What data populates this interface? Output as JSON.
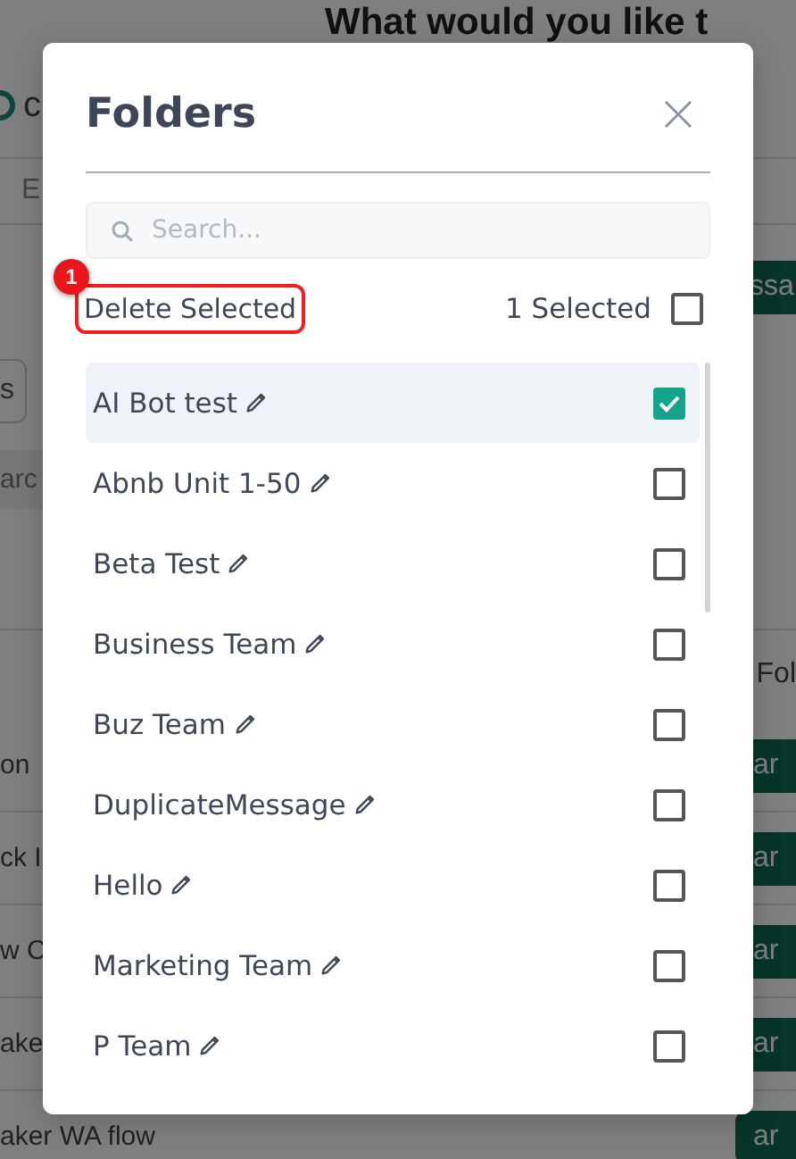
{
  "background": {
    "heading": "What would you like t",
    "logo_text": "c",
    "tab_text": "E",
    "top_button": "ssa",
    "left_button": "s",
    "search_text": "arc",
    "column_header": "Fol",
    "rows": [
      {
        "name": "on",
        "action": "ar"
      },
      {
        "name": "ck I",
        "action": "ar"
      },
      {
        "name": "w C",
        "action": "ar"
      },
      {
        "name": "ake",
        "action": "ar"
      },
      {
        "name": "aker WA flow",
        "action": "ar"
      }
    ]
  },
  "dialog": {
    "title": "Folders",
    "search": {
      "placeholder": "Search..."
    },
    "delete_button": "Delete Selected",
    "selected_count": "1 Selected",
    "select_all_checked": false,
    "folders": [
      {
        "name": "AI Bot test",
        "checked": true,
        "selected": true
      },
      {
        "name": "Abnb Unit 1-50",
        "checked": false,
        "selected": false
      },
      {
        "name": "Beta Test",
        "checked": false,
        "selected": false
      },
      {
        "name": "Business Team",
        "checked": false,
        "selected": false
      },
      {
        "name": "Buz Team",
        "checked": false,
        "selected": false
      },
      {
        "name": "DuplicateMessage",
        "checked": false,
        "selected": false
      },
      {
        "name": "Hello",
        "checked": false,
        "selected": false
      },
      {
        "name": "Marketing Team",
        "checked": false,
        "selected": false
      },
      {
        "name": "P Team",
        "checked": false,
        "selected": false
      }
    ]
  },
  "annotation": {
    "label": "1"
  }
}
